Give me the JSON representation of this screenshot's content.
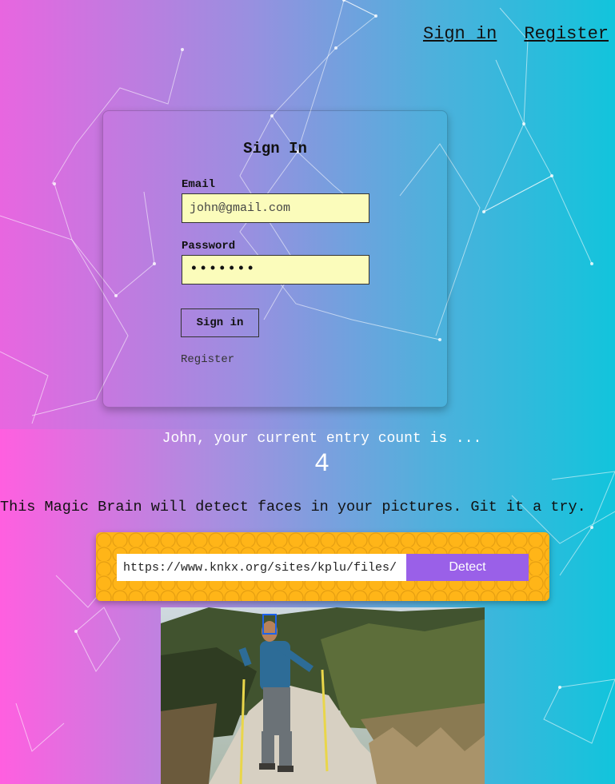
{
  "nav": {
    "signin_label": "Sign in",
    "register_label": "Register"
  },
  "signin_form": {
    "title": "Sign In",
    "email_label": "Email",
    "email_value": "john@gmail.com",
    "password_label": "Password",
    "password_value": "•••••••",
    "submit_label": "Sign in",
    "register_link": "Register"
  },
  "rank": {
    "message": "John, your current entry count is ...",
    "count": "4"
  },
  "tagline": "This Magic Brain will detect faces in your pictures. Git it a try.",
  "image_form": {
    "url_value": "https://www.knkx.org/sites/kplu/files/",
    "detect_label": "Detect"
  },
  "colors": {
    "gradient_left": "#e866e0",
    "gradient_right": "#12c4dc",
    "input_bg": "#fbfcbb",
    "panel": "#ffb518",
    "detect_button": "#9a60e8",
    "face_box": "#1e63e9"
  }
}
